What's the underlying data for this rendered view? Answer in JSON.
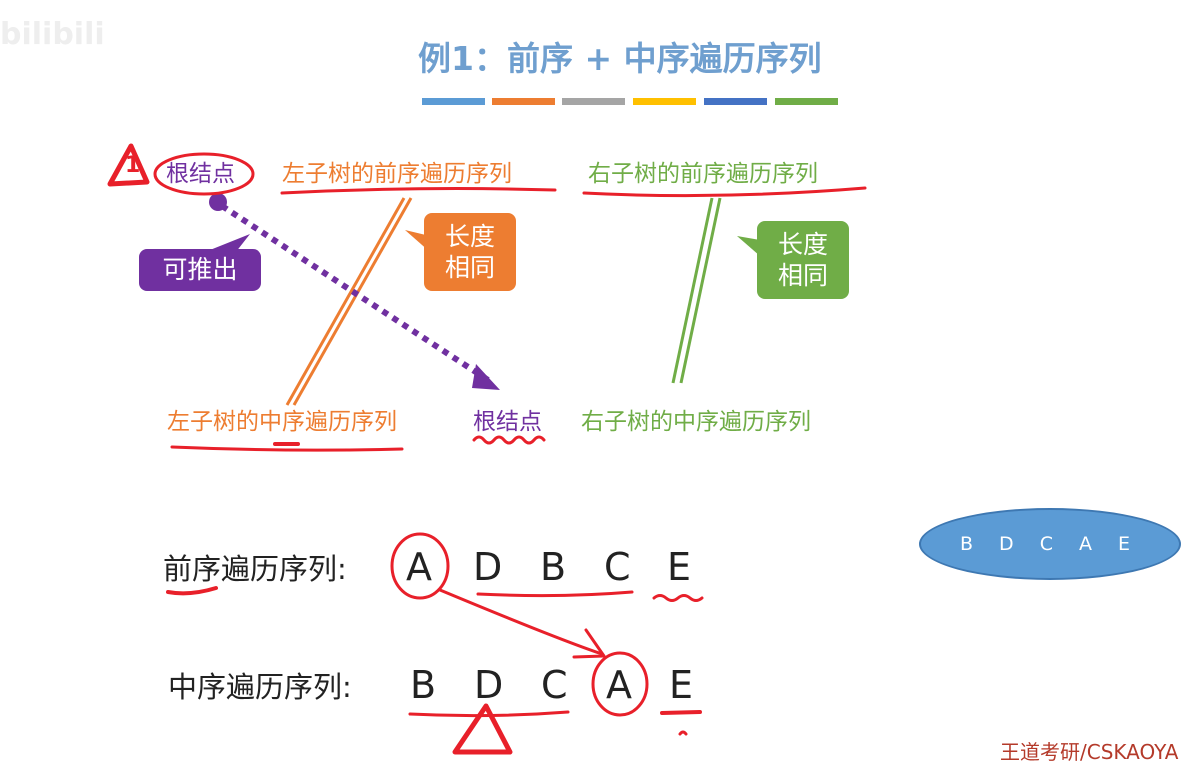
{
  "watermark": "bilibili",
  "title": "例1：前序 + 中序遍历序列",
  "title_bar_colors": [
    "#5b9bd5",
    "#ed7d31",
    "#a5a5a5",
    "#ffc000",
    "#4472c4",
    "#70ad47"
  ],
  "top_row": {
    "root": "根结点",
    "left_preorder": "左子树的前序遍历序列",
    "right_preorder": "右子树的前序遍历序列"
  },
  "bottom_row": {
    "left_inorder": "左子树的中序遍历序列",
    "root": "根结点",
    "right_inorder": "右子树的中序遍历序列"
  },
  "callouts": {
    "can_infer": "可推出",
    "left_same_length": [
      "长度",
      "相同"
    ],
    "right_same_length": [
      "长度",
      "相同"
    ]
  },
  "annotation_mark": "1",
  "preorder": {
    "label": "前序遍历序列:",
    "letters": [
      "A",
      "D",
      "B",
      "C",
      "E"
    ]
  },
  "inorder": {
    "label": "中序遍历序列:",
    "letters": [
      "B",
      "D",
      "C",
      "A",
      "E"
    ]
  },
  "ellipse_text": "B D C A E",
  "footer": "王道考研/CSKAOYA",
  "colors": {
    "title": "#6f9fcf",
    "root_purple": "#7030a0",
    "left_orange": "#ed7d31",
    "right_green": "#70ad47",
    "annotation_red": "#e8202a"
  }
}
